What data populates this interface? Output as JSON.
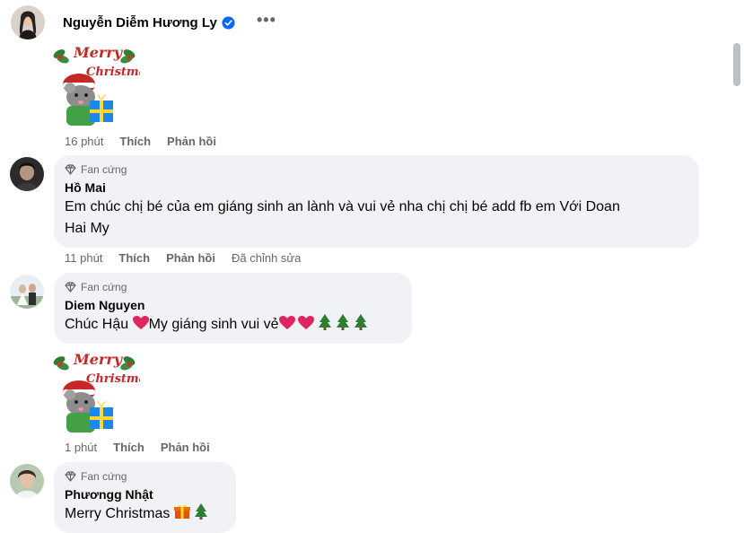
{
  "post_author": {
    "name": "Nguyễn Diễm Hương Ly",
    "verified": true,
    "more_label": "•••"
  },
  "sticker_text": {
    "line1": "Merry",
    "line2": "Christmas"
  },
  "first_meta": {
    "time": "16 phút",
    "like": "Thích",
    "reply": "Phản hồi"
  },
  "comments": [
    {
      "badge": "Fan cứng",
      "author": "Hồ Mai",
      "line1": "Em chúc chị bé của em giáng sinh an lành và vui vẻ nha chị chị bé add fb em Với Doan",
      "line2": "Hai My",
      "time": "11 phút",
      "like": "Thích",
      "reply": "Phản hồi",
      "edited": "Đã chỉnh sửa"
    },
    {
      "badge": "Fan cứng",
      "author": "Diem Nguyen",
      "text_a": "Chúc Hậu ",
      "text_b": "My giáng sinh vui vẻ",
      "time": "1 phút",
      "like": "Thích",
      "reply": "Phản hồi"
    },
    {
      "badge": "Fan cứng",
      "author": "Phươngg Nhật",
      "text": "Merry Christmas "
    }
  ],
  "colors": {
    "bubble": "#f0f2f5",
    "meta": "#65676b",
    "verified": "#0866ff",
    "heart": "#e0245e"
  }
}
